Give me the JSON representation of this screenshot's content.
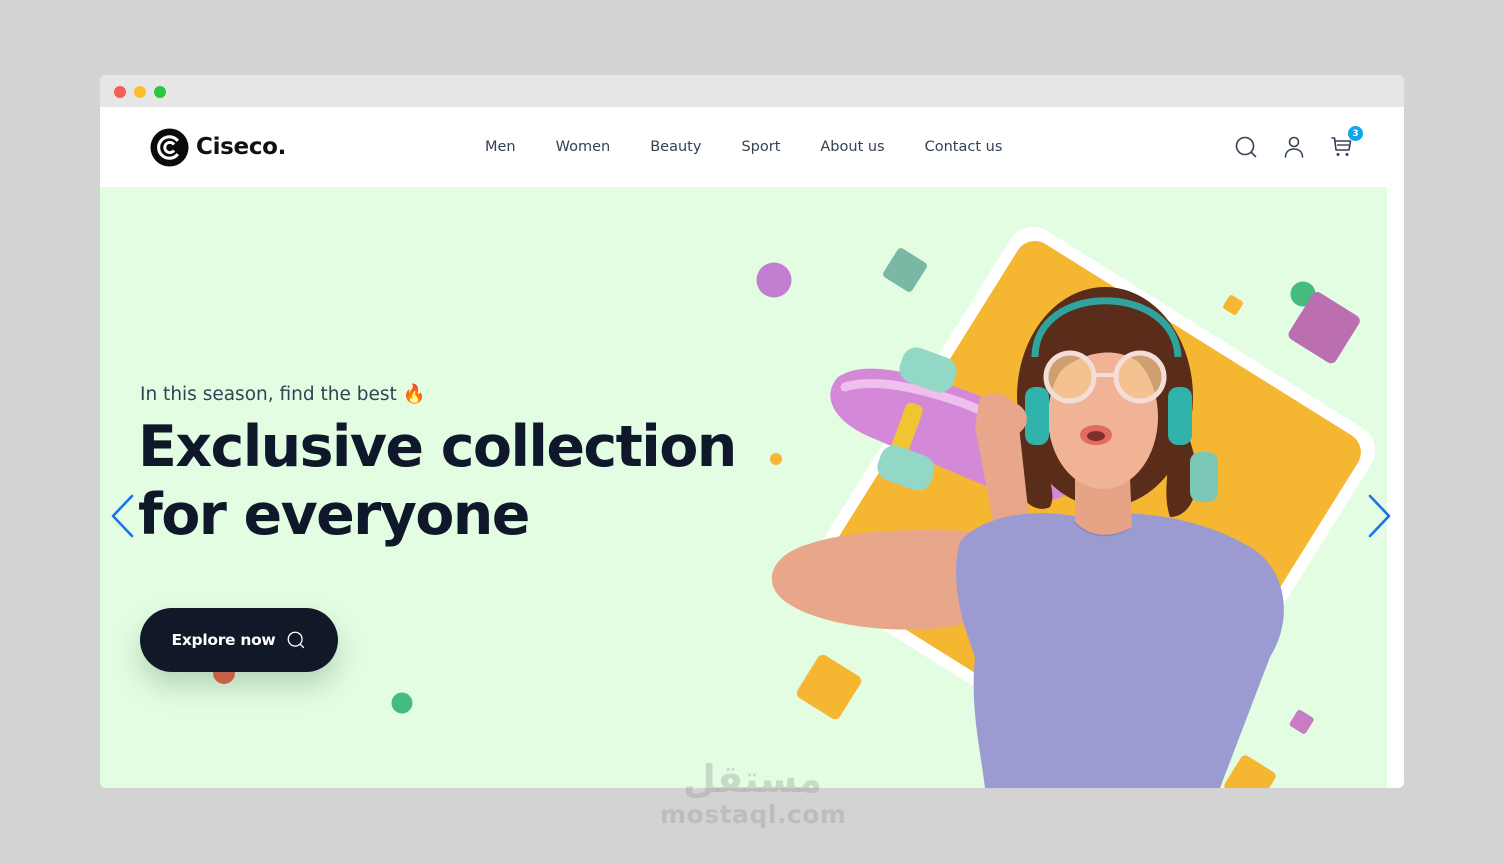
{
  "window": {
    "controls": [
      "close",
      "minimize",
      "maximize"
    ]
  },
  "brand": {
    "name": "Ciseco.",
    "logo_icon": "ciseco-logo-icon"
  },
  "nav": {
    "links": [
      {
        "label": "Men"
      },
      {
        "label": "Women"
      },
      {
        "label": "Beauty"
      },
      {
        "label": "Sport"
      },
      {
        "label": "About us"
      },
      {
        "label": "Contact us"
      }
    ],
    "icons": {
      "search": "search-icon",
      "account": "user-icon",
      "cart": "shopping-cart-icon"
    },
    "cart_count": "3"
  },
  "hero": {
    "subtitle": "In this season, find the best 🔥",
    "title": "Exclusive collection for everyone",
    "cta_label": "Explore now",
    "cta_icon": "search-icon",
    "prev_icon": "chevron-left-icon",
    "next_icon": "chevron-right-icon",
    "image_alt": "Woman wearing glasses and headphones holding a pink skateboard"
  },
  "colors": {
    "hero_bg": "#e3fde3",
    "primary_dark": "#111827",
    "accent_yellow": "#f5b731",
    "accent_purple": "#c27fd2",
    "accent_teal": "#7bb7a5",
    "accent_green": "#45bb7f",
    "accent_red": "#ea5c4a",
    "badge_blue": "#0ea5e9",
    "arrow_blue": "#1a73e8"
  },
  "watermark": {
    "arabic": "مستقل",
    "latin": "mostaql.com"
  }
}
